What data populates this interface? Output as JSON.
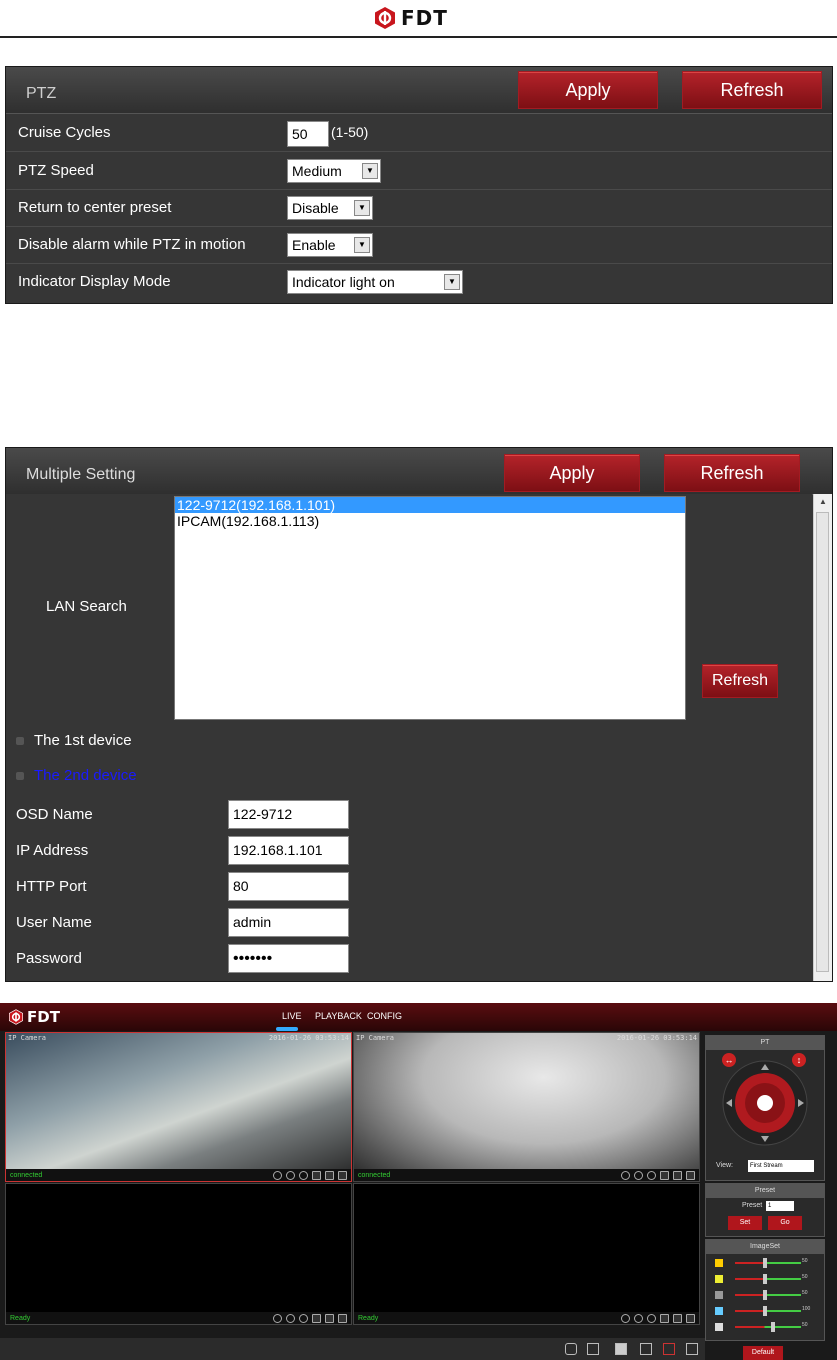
{
  "header": {
    "brand": "FDT"
  },
  "ptz": {
    "title": "PTZ",
    "apply": "Apply",
    "refresh": "Refresh",
    "rows": [
      {
        "label": "Cruise Cycles",
        "value": "50",
        "hint": "(1-50)"
      },
      {
        "label": "PTZ Speed",
        "value": "Medium"
      },
      {
        "label": "Return to center preset",
        "value": "Disable"
      },
      {
        "label": "Disable alarm while PTZ in motion",
        "value": "Enable"
      },
      {
        "label": "Indicator Display Mode",
        "value": "Indicator light on"
      }
    ]
  },
  "multiple": {
    "title": "Multiple Setting",
    "apply": "Apply",
    "refresh": "Refresh",
    "lan_label": "LAN Search",
    "devices_list": [
      "122-9712(192.168.1.101)",
      "IPCAM(192.168.1.113)"
    ],
    "list_refresh": "Refresh",
    "device1": "The 1st device",
    "device2": "The 2nd device",
    "fields": [
      {
        "label": "OSD Name",
        "value": "122-9712"
      },
      {
        "label": "IP Address",
        "value": "192.168.1.101"
      },
      {
        "label": "HTTP Port",
        "value": "80"
      },
      {
        "label": "User Name",
        "value": "admin"
      },
      {
        "label": "Password",
        "value": "•••••••"
      }
    ]
  },
  "app": {
    "brand": "FDT",
    "nav": [
      "LIVE",
      "PLAYBACK",
      "CONFIG"
    ],
    "cams": [
      {
        "name": "IP Camera",
        "time": "2016-01-26 03:53:14",
        "status": "connected"
      },
      {
        "name": "IP Camera",
        "time": "2016-01-26 03:53:14",
        "status": "connected"
      },
      {
        "name": "",
        "time": "",
        "status": "Ready"
      },
      {
        "name": "",
        "time": "",
        "status": "Ready"
      }
    ],
    "pt": {
      "title": "PT",
      "view_label": "View:",
      "view_value": "First Stream"
    },
    "preset": {
      "title": "Preset",
      "label": "Preset",
      "value": "1",
      "set": "Set",
      "go": "Go"
    },
    "imageset": {
      "title": "ImageSet",
      "values": [
        "50",
        "50",
        "50",
        "100",
        "50"
      ],
      "default": "Default"
    }
  },
  "colors": {
    "accent": "#a31b22",
    "panel": "#363636"
  }
}
